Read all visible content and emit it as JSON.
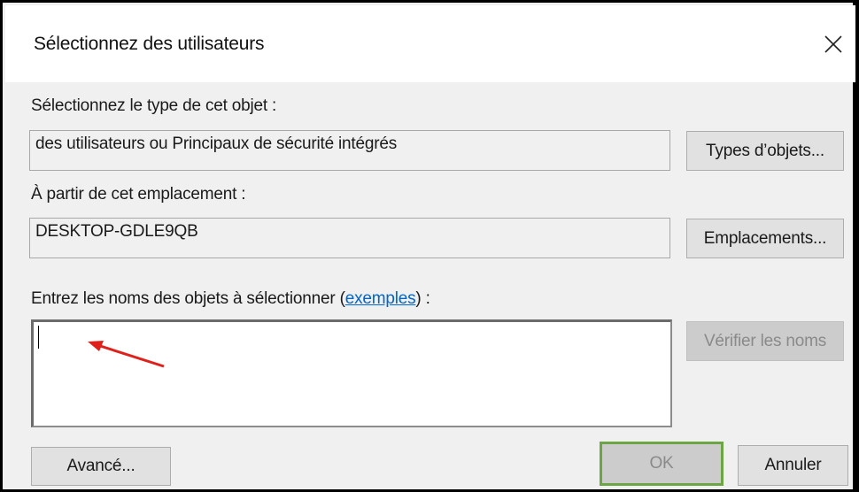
{
  "dialog": {
    "title": "Sélectionnez des utilisateurs",
    "close_glyph": "✕"
  },
  "object_type": {
    "label": "Sélectionnez le type de cet objet :",
    "value": "des utilisateurs ou Principaux de sécurité intégrés",
    "button": "Types d’objets..."
  },
  "location": {
    "label": "À partir de cet emplacement :",
    "value": "DESKTOP-GDLE9QB",
    "button": "Emplacements..."
  },
  "names": {
    "label_prefix": "Entrez les noms des objets à sélectionner (",
    "link": "exemples",
    "label_suffix": ") :",
    "value": "",
    "check_button": "Vérifier les noms"
  },
  "footer": {
    "advanced_button": "Avancé...",
    "ok_button": "OK",
    "cancel_button": "Annuler"
  },
  "colors": {
    "arrow": "#e0201b",
    "focus_border": "#6ca544",
    "link": "#0066cc"
  },
  "icons": {
    "close": "close-icon",
    "annotation": "red-arrow-icon"
  }
}
